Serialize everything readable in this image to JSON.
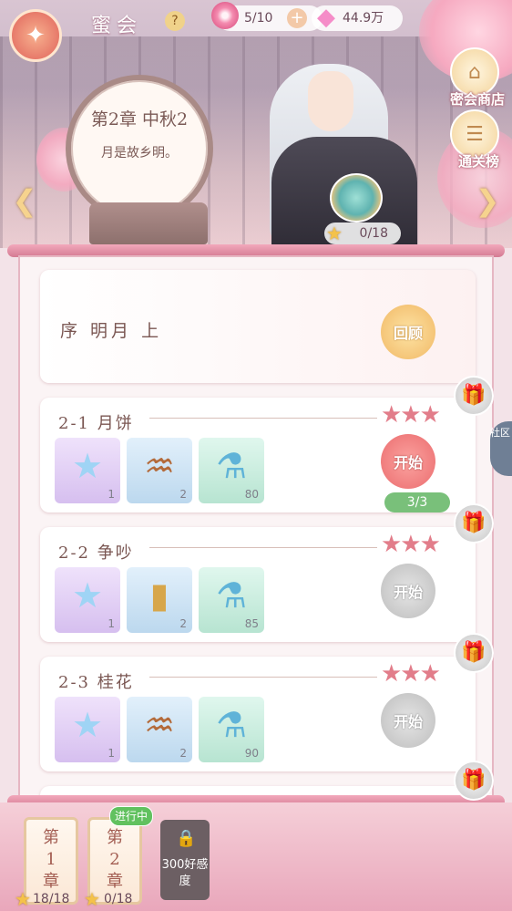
{
  "header": {
    "title": "蜜会",
    "help_icon": "question-icon",
    "flowers": "5/10",
    "gems": "44.9万"
  },
  "side": {
    "shop_label": "密会商店",
    "rank_label": "通关榜"
  },
  "chapter": {
    "title": "第2章 中秋2",
    "subtitle": "月是故乡明。",
    "chest_progress": "0/18"
  },
  "prologue": {
    "label": "序 明月 上",
    "button": "回顾"
  },
  "levels": [
    {
      "name": "2-1 月饼",
      "stars": "★★★",
      "items": [
        {
          "icon": "star-item-icon",
          "count": "1"
        },
        {
          "icon": "comb-icon",
          "count": "2"
        },
        {
          "icon": "potion-icon",
          "count": "80"
        }
      ],
      "button": "开始",
      "button_state": "active",
      "attempts": "3/3"
    },
    {
      "name": "2-2 争吵",
      "stars": "★★★",
      "items": [
        {
          "icon": "star-item-icon",
          "count": "1"
        },
        {
          "icon": "hairpin-icon",
          "count": "2"
        },
        {
          "icon": "potion-icon",
          "count": "85"
        }
      ],
      "button": "开始",
      "button_state": "locked"
    },
    {
      "name": "2-3 桂花",
      "stars": "★★★",
      "items": [
        {
          "icon": "star-item-icon",
          "count": "1"
        },
        {
          "icon": "comb-icon",
          "count": "2"
        },
        {
          "icon": "potion-icon",
          "count": "90"
        }
      ],
      "button": "开始",
      "button_state": "locked"
    }
  ],
  "community": "社区",
  "bottom": {
    "ch1_text": "第1章",
    "ch1_count": "18/18",
    "ch2_badge": "进行中",
    "ch2_text": "第2章",
    "ch2_count": "0/18",
    "favor_text": "300好感度"
  },
  "colors": {
    "accent_pink": "#e27d8a",
    "active_button": "#eb6c6e",
    "progress_green": "#79c07a"
  }
}
